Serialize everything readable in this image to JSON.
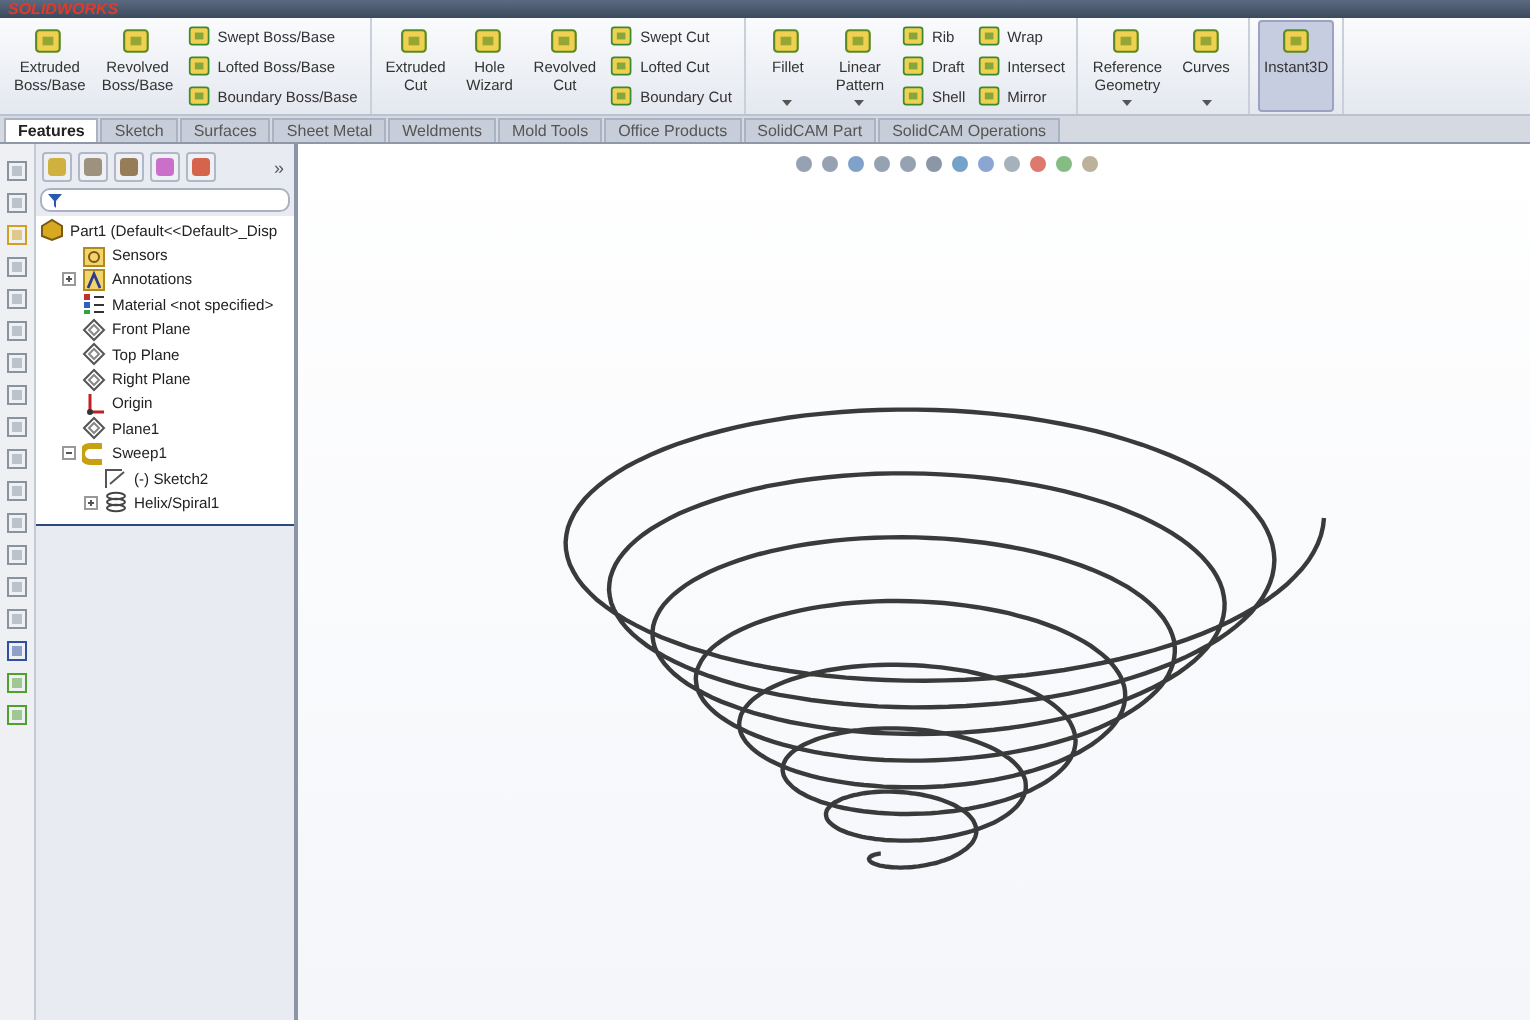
{
  "app": {
    "logo": "SOLIDWORKS"
  },
  "ribbon": {
    "groups": [
      {
        "items": [
          {
            "kind": "large",
            "label": "Extruded\nBoss/Base",
            "dropdown": false,
            "selected": false
          },
          {
            "kind": "large",
            "label": "Revolved\nBoss/Base",
            "dropdown": false,
            "selected": false
          },
          {
            "kind": "stack",
            "items": [
              {
                "label": "Swept Boss/Base"
              },
              {
                "label": "Lofted Boss/Base"
              },
              {
                "label": "Boundary Boss/Base"
              }
            ]
          }
        ]
      },
      {
        "items": [
          {
            "kind": "large",
            "label": "Extruded\nCut",
            "dropdown": false,
            "selected": false
          },
          {
            "kind": "large",
            "label": "Hole\nWizard",
            "dropdown": false,
            "selected": false
          },
          {
            "kind": "large",
            "label": "Revolved\nCut",
            "dropdown": false,
            "selected": false
          },
          {
            "kind": "stack",
            "items": [
              {
                "label": "Swept Cut"
              },
              {
                "label": "Lofted Cut"
              },
              {
                "label": "Boundary Cut"
              }
            ]
          }
        ]
      },
      {
        "items": [
          {
            "kind": "large",
            "label": "Fillet",
            "dropdown": true,
            "selected": false
          },
          {
            "kind": "large",
            "label": "Linear\nPattern",
            "dropdown": true,
            "selected": false
          },
          {
            "kind": "stack",
            "items": [
              {
                "label": "Rib"
              },
              {
                "label": "Draft"
              },
              {
                "label": "Shell"
              }
            ]
          },
          {
            "kind": "stack",
            "items": [
              {
                "label": "Wrap"
              },
              {
                "label": "Intersect"
              },
              {
                "label": "Mirror"
              }
            ]
          }
        ]
      },
      {
        "items": [
          {
            "kind": "large",
            "label": "Reference\nGeometry",
            "dropdown": true,
            "selected": false
          },
          {
            "kind": "large",
            "label": "Curves",
            "dropdown": true,
            "selected": false
          }
        ]
      },
      {
        "items": [
          {
            "kind": "large",
            "label": "Instant3D",
            "dropdown": false,
            "selected": true
          }
        ]
      }
    ]
  },
  "tabs": [
    {
      "label": "Features",
      "selected": true
    },
    {
      "label": "Sketch",
      "selected": false
    },
    {
      "label": "Surfaces",
      "selected": false
    },
    {
      "label": "Sheet Metal",
      "selected": false
    },
    {
      "label": "Weldments",
      "selected": false
    },
    {
      "label": "Mold Tools",
      "selected": false
    },
    {
      "label": "Office Products",
      "selected": false
    },
    {
      "label": "SolidCAM Part",
      "selected": false
    },
    {
      "label": "SolidCAM Operations",
      "selected": false
    }
  ],
  "feature_manager": {
    "more": "»",
    "tree": [
      {
        "kind": "part",
        "label": "Part1  (Default<<Default>_Disp",
        "children": [
          {
            "kind": "sensor",
            "label": "Sensors"
          },
          {
            "kind": "annotation",
            "label": "Annotations",
            "expanded": false
          },
          {
            "kind": "material",
            "label": "Material <not specified>"
          },
          {
            "kind": "plane",
            "label": "Front Plane"
          },
          {
            "kind": "plane",
            "label": "Top Plane"
          },
          {
            "kind": "plane",
            "label": "Right Plane"
          },
          {
            "kind": "origin",
            "label": "Origin"
          },
          {
            "kind": "plane",
            "label": "Plane1"
          },
          {
            "kind": "sweep",
            "label": "Sweep1",
            "expanded": true,
            "children": [
              {
                "kind": "sketch",
                "label": "(-) Sketch2"
              },
              {
                "kind": "helix",
                "label": "Helix/Spiral1",
                "expanded": false
              }
            ]
          }
        ]
      }
    ]
  }
}
